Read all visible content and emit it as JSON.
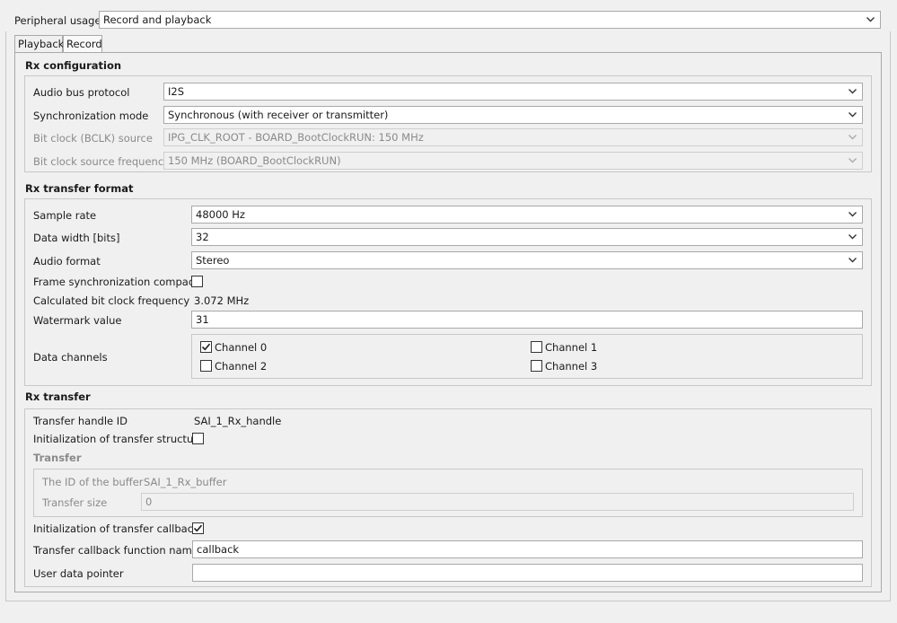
{
  "peripheral_usage": {
    "label": "Peripheral usage",
    "value": "Record and playback"
  },
  "tabs": [
    {
      "label": "Playback"
    },
    {
      "label": "Record"
    }
  ],
  "rx_configuration": {
    "title": "Rx configuration",
    "audio_bus_protocol": {
      "label": "Audio bus protocol",
      "value": "I2S"
    },
    "synchronization_mode": {
      "label": "Synchronization mode",
      "value": "Synchronous (with receiver or transmitter)"
    },
    "bit_clock_source": {
      "label": "Bit clock (BCLK) source",
      "value": "IPG_CLK_ROOT - BOARD_BootClockRUN: 150 MHz"
    },
    "bit_clock_source_frequency": {
      "label": "Bit clock source frequency",
      "value": "150 MHz (BOARD_BootClockRUN)"
    }
  },
  "rx_transfer_format": {
    "title": "Rx transfer format",
    "sample_rate": {
      "label": "Sample rate",
      "value": "48000 Hz"
    },
    "data_width": {
      "label": "Data width [bits]",
      "value": "32"
    },
    "audio_format": {
      "label": "Audio format",
      "value": "Stereo"
    },
    "frame_sync_compact": {
      "label": "Frame synchronization compact",
      "checked": false
    },
    "calculated_bit_clock": {
      "label": "Calculated bit clock frequency",
      "value": "3.072 MHz"
    },
    "watermark": {
      "label": "Watermark value",
      "value": "31"
    },
    "data_channels": {
      "label": "Data channels",
      "channels": [
        {
          "label": "Channel 0",
          "checked": true
        },
        {
          "label": "Channel 1",
          "checked": false
        },
        {
          "label": "Channel 2",
          "checked": false
        },
        {
          "label": "Channel 3",
          "checked": false
        }
      ]
    }
  },
  "rx_transfer": {
    "title": "Rx transfer",
    "transfer_handle_id": {
      "label": "Transfer handle ID",
      "value": "SAI_1_Rx_handle"
    },
    "init_transfer_structure": {
      "label": "Initialization of transfer structure",
      "checked": false
    },
    "transfer": {
      "title": "Transfer",
      "buffer_id": {
        "label": "The ID of the buffer",
        "value": "SAI_1_Rx_buffer"
      },
      "transfer_size": {
        "label": "Transfer size",
        "value": "0"
      }
    },
    "init_transfer_callback": {
      "label": "Initialization of transfer callback",
      "checked": true
    },
    "callback_function_name": {
      "label": "Transfer callback function name",
      "value": "callback"
    },
    "user_data_pointer": {
      "label": "User data pointer",
      "value": ""
    }
  }
}
